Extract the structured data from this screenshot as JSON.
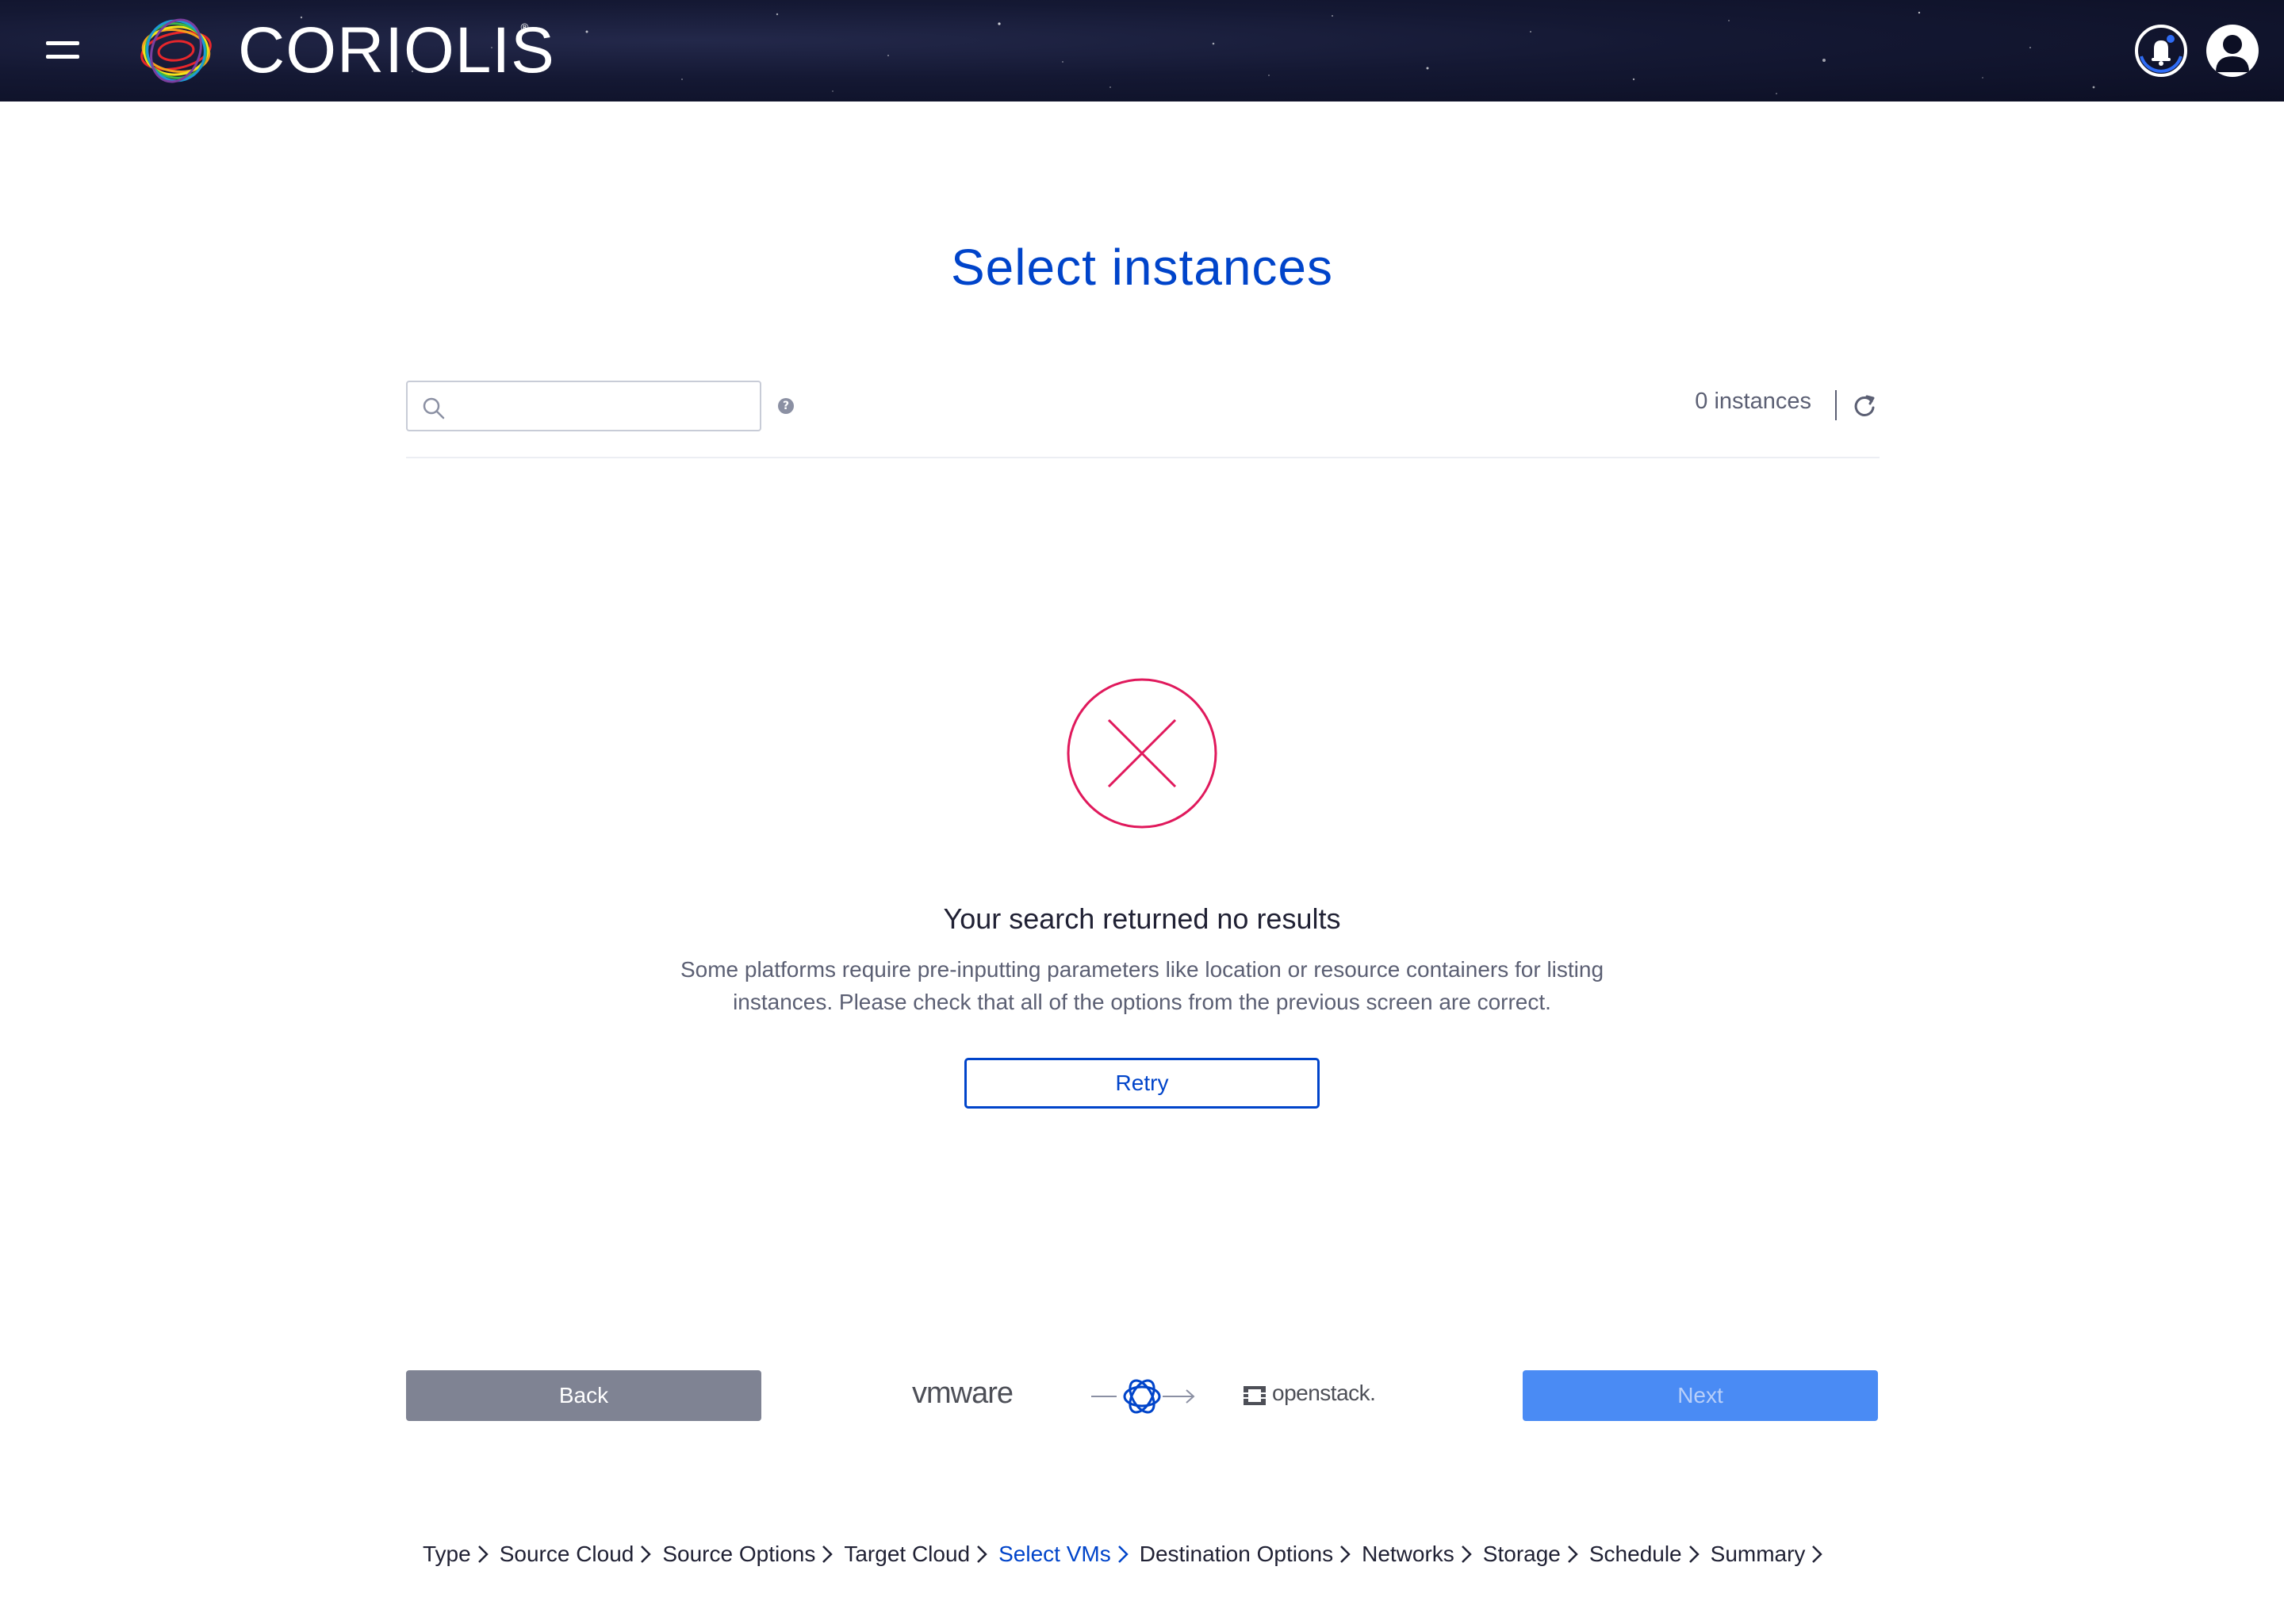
{
  "header": {
    "brand": "CORIOLIS",
    "brand_mark": "®"
  },
  "page": {
    "title": "Select instances"
  },
  "toolbar": {
    "search_placeholder": "",
    "help_glyph": "?",
    "instances_count": "0 instances"
  },
  "empty_state": {
    "title": "Your search returned no results",
    "message": "Some platforms require pre-inputting parameters like location or resource containers for listing instances. Please check that all of the options from the previous screen are correct.",
    "retry_label": "Retry",
    "icon_color": "#e0195c"
  },
  "footer": {
    "back_label": "Back",
    "next_label": "Next",
    "source_platform": "vmware",
    "target_platform": "openstack."
  },
  "steps": [
    {
      "label": "Type",
      "active": false
    },
    {
      "label": "Source Cloud",
      "active": false
    },
    {
      "label": "Source Options",
      "active": false
    },
    {
      "label": "Target Cloud",
      "active": false
    },
    {
      "label": "Select VMs",
      "active": true
    },
    {
      "label": "Destination Options",
      "active": false
    },
    {
      "label": "Networks",
      "active": false
    },
    {
      "label": "Storage",
      "active": false
    },
    {
      "label": "Schedule",
      "active": false
    },
    {
      "label": "Summary",
      "active": false
    }
  ],
  "colors": {
    "accent": "#0044ca",
    "next_button": "#4a8bf4",
    "back_button": "#7f8393",
    "error": "#e0195c"
  }
}
